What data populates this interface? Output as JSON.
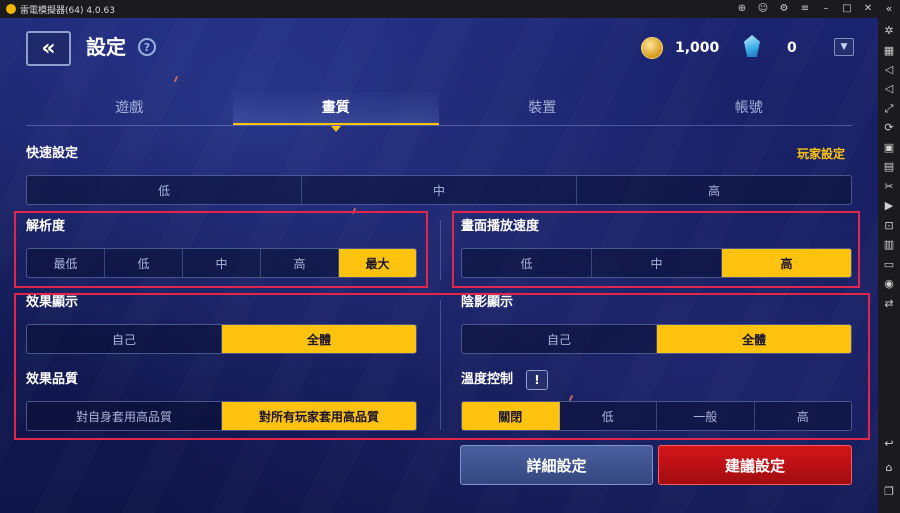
{
  "window": {
    "title": "雷電模擬器(64) 4.0.63"
  },
  "header": {
    "title": "設定",
    "help_icon": "question-circle-icon",
    "coins": "1,000",
    "gems": "0"
  },
  "tabs": [
    {
      "label": "遊戲",
      "active": false
    },
    {
      "label": "畫質",
      "active": true
    },
    {
      "label": "裝置",
      "active": false
    },
    {
      "label": "帳號",
      "active": false
    }
  ],
  "quick_settings": {
    "label": "快速設定",
    "link": "玩家設定",
    "options": [
      "低",
      "中",
      "高"
    ]
  },
  "resolution": {
    "label": "解析度",
    "options": [
      "最低",
      "低",
      "中",
      "高",
      "最大"
    ],
    "selected": "最大"
  },
  "frame_rate": {
    "label": "畫面播放速度",
    "options": [
      "低",
      "中",
      "高"
    ],
    "selected": "高"
  },
  "effect_display": {
    "label": "效果顯示",
    "options": [
      "自己",
      "全體"
    ],
    "selected": "全體"
  },
  "shadow_display": {
    "label": "陰影顯示",
    "options": [
      "自己",
      "全體"
    ],
    "selected": "全體"
  },
  "effect_quality": {
    "label": "效果品質",
    "options": [
      "對自身套用高品質",
      "對所有玩家套用高品質"
    ],
    "selected": "對所有玩家套用高品質"
  },
  "temperature_control": {
    "label": "溫度控制",
    "info_icon": "!",
    "options": [
      "關閉",
      "低",
      "一般",
      "高"
    ],
    "selected": "關閉"
  },
  "buttons": {
    "detail": "詳細設定",
    "suggest": "建議設定"
  },
  "colors": {
    "accent": "#ffc20e",
    "highlight_box": "#e2264a",
    "suggest_button": "#d41419"
  }
}
